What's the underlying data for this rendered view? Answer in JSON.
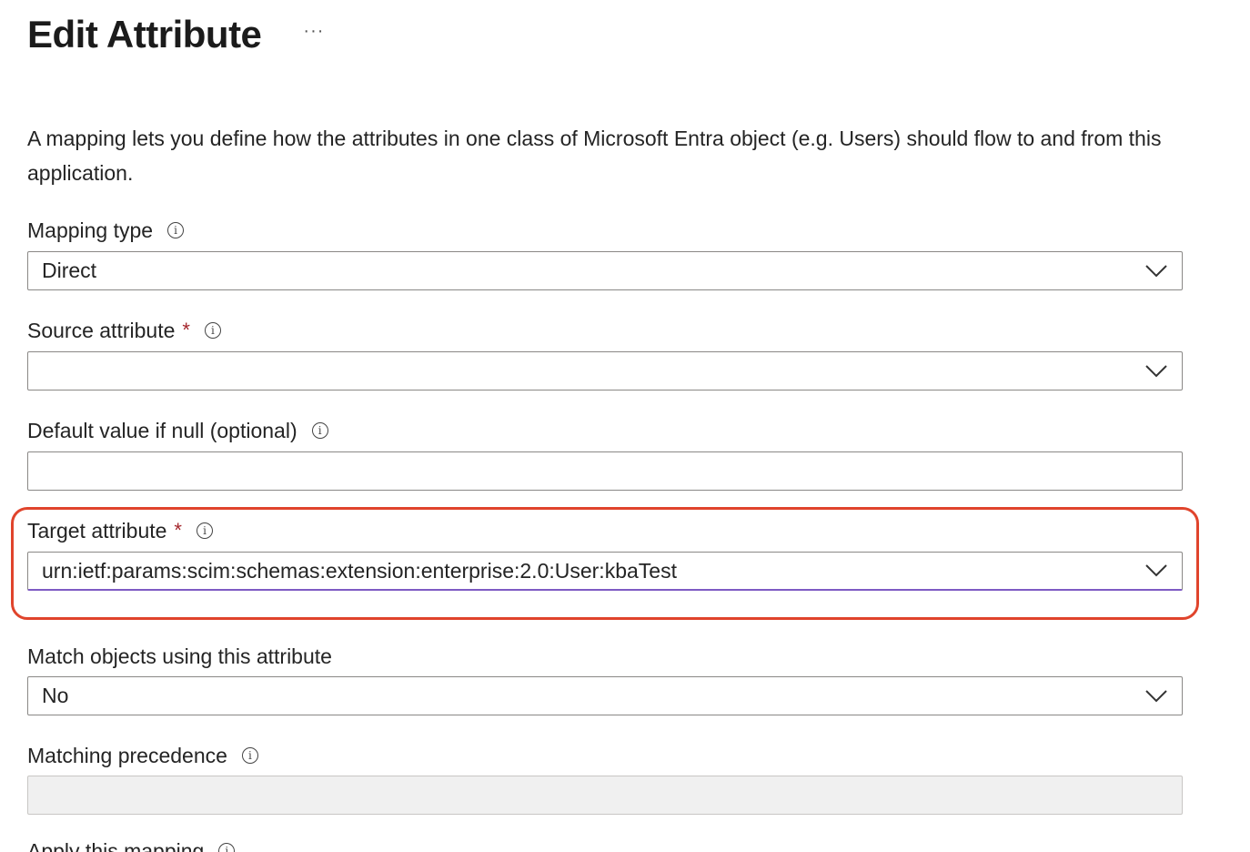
{
  "header": {
    "title": "Edit Attribute",
    "more_label": "···"
  },
  "description": "A mapping lets you define how the attributes in one class of Microsoft Entra object (e.g. Users) should flow to and from this application.",
  "fields": {
    "mapping_type": {
      "label": "Mapping type",
      "value": "Direct"
    },
    "source_attribute": {
      "label": "Source attribute",
      "required_mark": "*",
      "value": ""
    },
    "default_value": {
      "label": "Default value if null (optional)",
      "value": ""
    },
    "target_attribute": {
      "label": "Target attribute",
      "required_mark": "*",
      "value": "urn:ietf:params:scim:schemas:extension:enterprise:2.0:User:kbaTest"
    },
    "match_objects": {
      "label": "Match objects using this attribute",
      "value": "No"
    },
    "matching_precedence": {
      "label": "Matching precedence",
      "value": ""
    },
    "apply_mapping": {
      "label": "Apply this mapping"
    }
  },
  "icons": {
    "info": "info-icon",
    "dropdown": "chevron-down-icon"
  },
  "colors": {
    "highlight": "#e0442c",
    "required": "#a4262c",
    "focus": "#7e5bc4"
  }
}
